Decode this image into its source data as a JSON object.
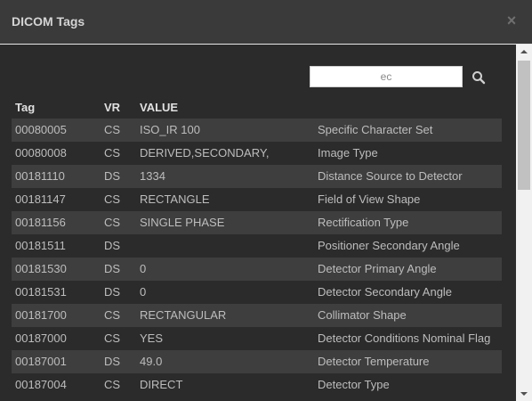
{
  "dialog": {
    "title": "DICOM Tags",
    "close_label": "×"
  },
  "search": {
    "value": "ec",
    "icon": "search-icon"
  },
  "table": {
    "headers": [
      "Tag",
      "VR",
      "VALUE"
    ],
    "rows": [
      {
        "tag": "00080005",
        "vr": "CS",
        "value": "ISO_IR 100",
        "description": "Specific Character Set"
      },
      {
        "tag": "00080008",
        "vr": "CS",
        "value": "DERIVED,SECONDARY,",
        "description": "Image Type"
      },
      {
        "tag": "00181110",
        "vr": "DS",
        "value": "1334",
        "description": "Distance Source to Detector"
      },
      {
        "tag": "00181147",
        "vr": "CS",
        "value": "RECTANGLE",
        "description": "Field of View Shape"
      },
      {
        "tag": "00181156",
        "vr": "CS",
        "value": "SINGLE PHASE",
        "description": "Rectification Type"
      },
      {
        "tag": "00181511",
        "vr": "DS",
        "value": "",
        "description": "Positioner Secondary Angle"
      },
      {
        "tag": "00181530",
        "vr": "DS",
        "value": "0",
        "description": "Detector Primary Angle"
      },
      {
        "tag": "00181531",
        "vr": "DS",
        "value": "0",
        "description": "Detector Secondary Angle"
      },
      {
        "tag": "00181700",
        "vr": "CS",
        "value": "RECTANGULAR",
        "description": "Collimator Shape"
      },
      {
        "tag": "00187000",
        "vr": "CS",
        "value": "YES",
        "description": "Detector Conditions Nominal Flag"
      },
      {
        "tag": "00187001",
        "vr": "DS",
        "value": "49.0",
        "description": "Detector Temperature"
      },
      {
        "tag": "00187004",
        "vr": "CS",
        "value": "DIRECT",
        "description": "Detector Type"
      }
    ]
  },
  "colors": {
    "background": "#2b2b2b",
    "header": "#3a3a3a",
    "row_stripe": "#3e3e3e",
    "text": "#bdbdbd"
  }
}
